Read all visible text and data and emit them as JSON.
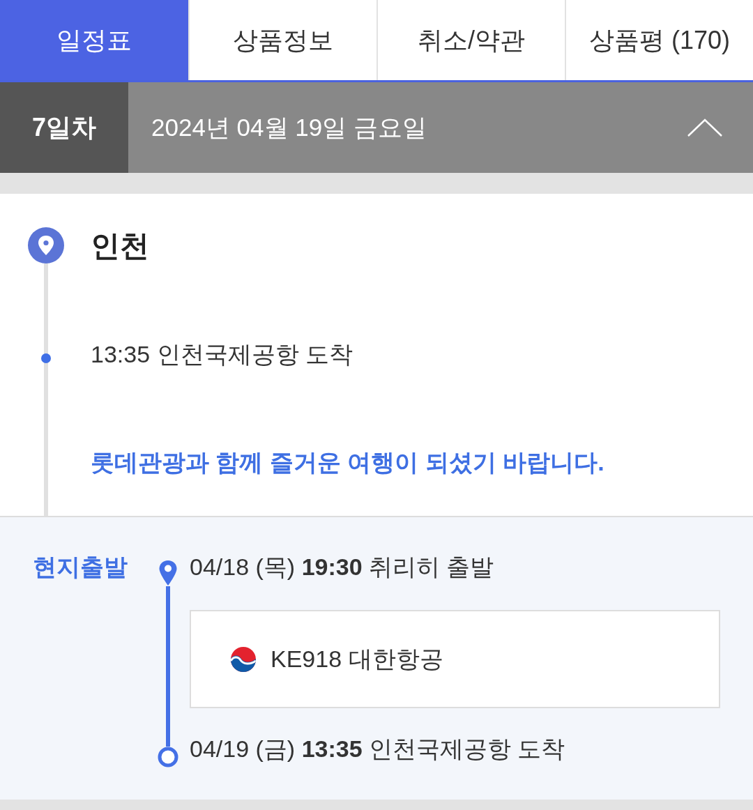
{
  "tabs": [
    {
      "label": "일정표",
      "selected": true
    },
    {
      "label": "상품정보",
      "selected": false
    },
    {
      "label": "취소/약관",
      "selected": false
    },
    {
      "label": "상품평 (170)",
      "selected": false
    }
  ],
  "day_bar": {
    "day": "7일차",
    "date": "2024년 04월 19일 금요일",
    "expanded": true
  },
  "itinerary": {
    "place": "인천",
    "events": [
      {
        "text": "13:35 인천국제공항 도착"
      }
    ],
    "note": "롯데관광과 함께 즐거운 여행이 되셨기 바랍니다."
  },
  "flight": {
    "label": "현지출발",
    "departure": "04/18 (목) **19:30** 취리히 출발",
    "flight": "KE918 대한항공",
    "arrival": "04/19 (금) **13:35** 인천국제공항 도착"
  }
}
